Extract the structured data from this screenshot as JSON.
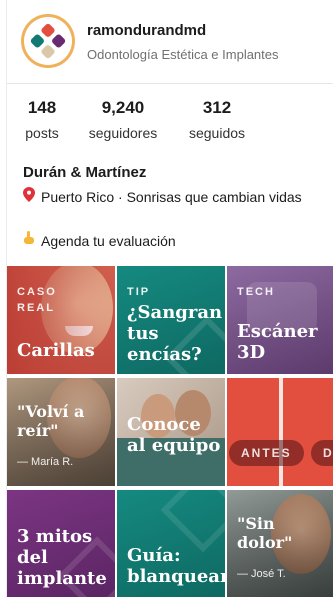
{
  "profile": {
    "username": "ramondurandmd",
    "subtitle": "Odontología Estética e Implantes",
    "display_name": "Durán & Martínez",
    "location_icon": "pin-icon",
    "location_text": "Puerto Rico · Sonrisas que cambian vidas",
    "cta_icon": "pointing-hand-icon",
    "cta_text": "Agenda tu evaluación"
  },
  "stats": [
    {
      "value": "148",
      "label": "posts"
    },
    {
      "value": "9,240",
      "label": "seguidores"
    },
    {
      "value": "312",
      "label": "seguidos"
    }
  ],
  "tiles": [
    {
      "tag": "CASO REAL",
      "title": "Carillas"
    },
    {
      "tag": "TIP",
      "title": "¿Sangran tus encías?"
    },
    {
      "tag": "TECH",
      "title": "Escáner 3D"
    },
    {
      "title": "\"Volví a reír\"",
      "sub": "— María R."
    },
    {
      "title": "Conoce al equipo"
    },
    {
      "pill_left": "ANTES",
      "pill_right": "DESPUÉS"
    },
    {
      "title": "3 mitos del implante"
    },
    {
      "title": "Guía: blanqueamiento"
    },
    {
      "title": "\"Sin dolor\"",
      "sub": "— José T."
    }
  ],
  "colors": {
    "avatar_ring": "#f0b15a",
    "teal": "#127a73",
    "purple": "#6a2a70",
    "coral": "#e34f3f"
  }
}
